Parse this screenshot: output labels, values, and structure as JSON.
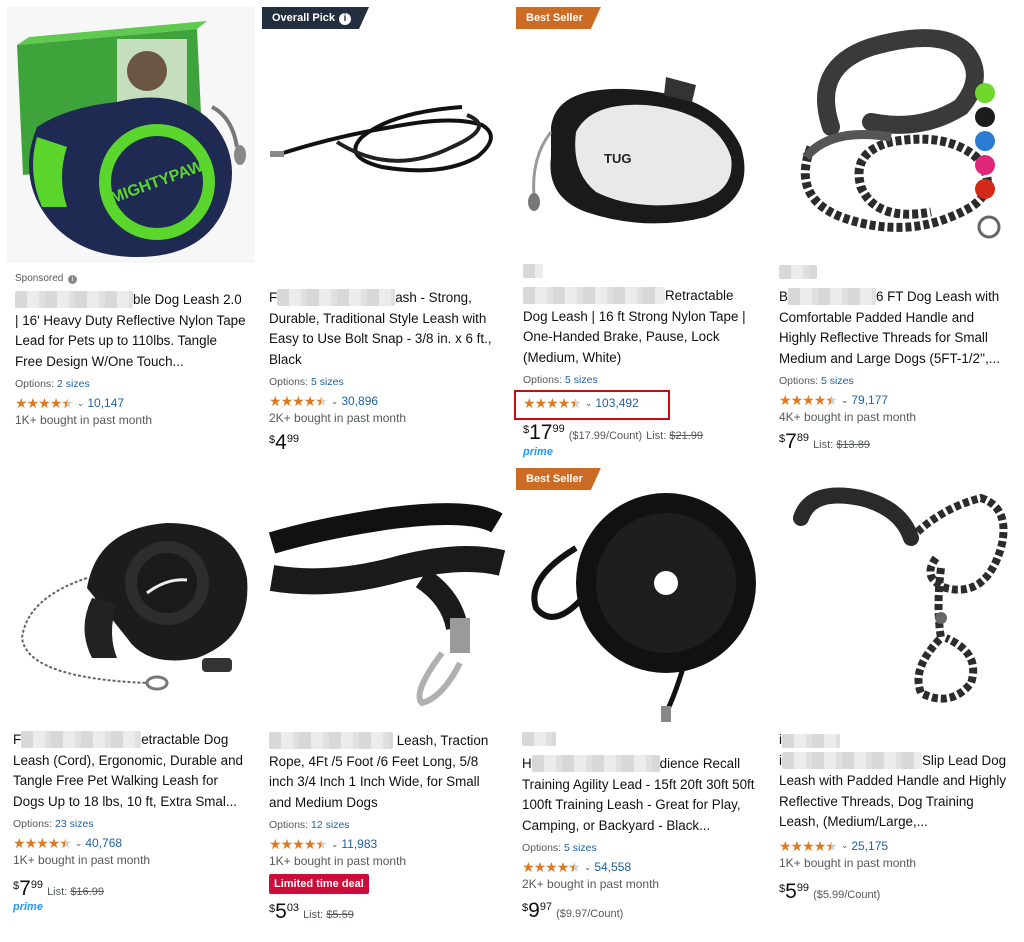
{
  "ui": {
    "sponsored": "Sponsored",
    "options_label": "Options:",
    "list_label": "List:",
    "caret": "⌄",
    "currency": "$",
    "prime": "prime"
  },
  "badges": {
    "overall_pick": "Overall Pick",
    "best_seller": "Best Seller",
    "limited_deal": "Limited time deal"
  },
  "products": [
    {
      "brand_text": "MIGHTYPAW",
      "title_tail": "ble Dog Leash",
      "title_rest": "2.0 | 16' Heavy Duty Reflective Nylon Tape Lead for Pets up to 110lbs. Tangle Free Design W/One Touch...",
      "sizes": "2 sizes",
      "reviews": "10,147",
      "bought": "1K+ bought in past month"
    },
    {
      "title_tail": "ash - Strong,",
      "title_rest": "Durable, Traditional Style Leash with Easy to Use Bolt Snap - 3/8 in. x 6 ft., Black",
      "sizes": "5 sizes",
      "reviews": "30,896",
      "bought": "2K+ bought in past month",
      "price_whole": "4",
      "price_frac": "99"
    },
    {
      "brand_text": "TUG",
      "title_tail": "Retractable",
      "title_rest": "Dog Leash | 16 ft Strong Nylon Tape | One-Handed Brake, Pause, Lock (Medium, White)",
      "sizes": "5 sizes",
      "reviews": "103,492",
      "price_whole": "17",
      "price_frac": "99",
      "unit": "($17.99/Count)",
      "list_price": "$21.99"
    },
    {
      "title_tail": "6 FT Dog Leash with",
      "title_rest": "Comfortable Padded Handle and Highly Reflective Threads for Small Medium and Large Dogs (5FT-1/2'',...",
      "sizes": "5 sizes",
      "reviews": "79,177",
      "bought": "4K+ bought in past month",
      "price_whole": "7",
      "price_frac": "89",
      "list_price": "$13.89"
    },
    {
      "title_tail": "etractable Dog",
      "title_rest": "Leash (Cord), Ergonomic, Durable and Tangle Free Pet Walking Leash for Dogs Up to 18 lbs, 10 ft, Extra Smal...",
      "sizes": "23 sizes",
      "reviews": "40,768",
      "bought": "1K+ bought in past month",
      "price_whole": "7",
      "price_frac": "99",
      "list_price": "$16.99"
    },
    {
      "title_tail": "Leash, Traction",
      "title_rest": "Rope, 4Ft /5 Foot /6 Feet Long, 5/8 inch 3/4 Inch 1 Inch Wide, for Small and Medium Dogs",
      "sizes": "12 sizes",
      "reviews": "11,983",
      "bought": "1K+ bought in past month",
      "price_whole": "5",
      "price_frac": "03",
      "list_price": "$5.59"
    },
    {
      "title_tail": "dience Recall",
      "title_rest": "Training Agility Lead - 15ft 20ft 30ft 50ft 100ft Training Leash - Great for Play, Camping, or Backyard - Black...",
      "sizes": "5 sizes",
      "reviews": "54,558",
      "bought": "2K+ bought in past month",
      "price_whole": "9",
      "price_frac": "97",
      "unit": "($9.97/Count)"
    },
    {
      "title_tail": "Slip Lead Dog",
      "title_rest": "Leash with Padded Handle and Highly Reflective Threads, Dog Training Leash, (Medium/Large,...",
      "reviews": "25,175",
      "bought": "1K+ bought in past month",
      "price_whole": "5",
      "price_frac": "99",
      "unit": "($5.99/Count)"
    }
  ],
  "colors": {
    "star": "#de7921",
    "link": "#2162a1",
    "deal": "#cc0c39",
    "badge_dark": "#232f3e",
    "badge_orange": "#cc6b24",
    "highlight": "#cc0c0c"
  }
}
